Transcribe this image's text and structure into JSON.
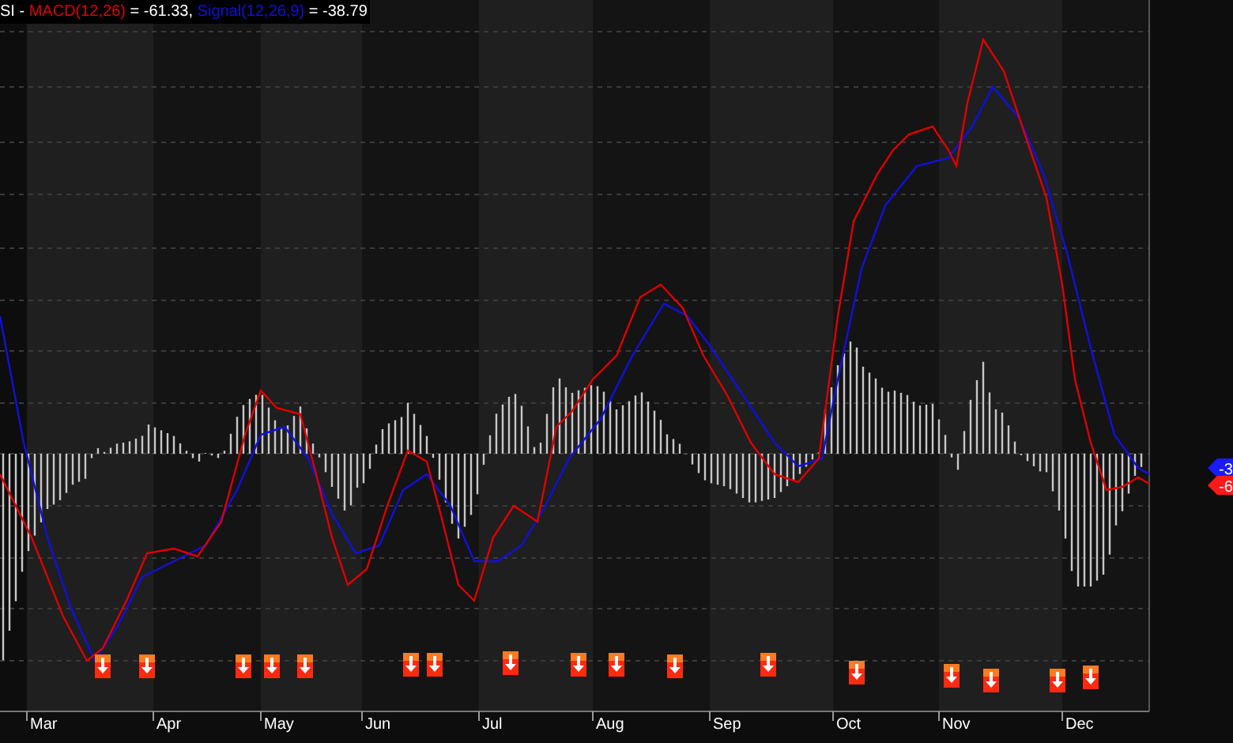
{
  "legend": {
    "prefix": "SI - ",
    "series": [
      {
        "name": "MACD(12,26)",
        "color": "#e00000",
        "reading": " = -61.33, "
      },
      {
        "name": "Signal(12,26,9)",
        "color": "#1010e0",
        "reading": " = -38.79"
      }
    ]
  },
  "axis_labels": [
    {
      "text": "-3",
      "color": "#1a1aff"
    },
    {
      "text": "-6",
      "color": "#ff1a1a"
    }
  ],
  "months": [
    "Mar",
    "Apr",
    "May",
    "Jun",
    "Jul",
    "Aug",
    "Sep",
    "Oct",
    "Nov",
    "Dec"
  ]
}
